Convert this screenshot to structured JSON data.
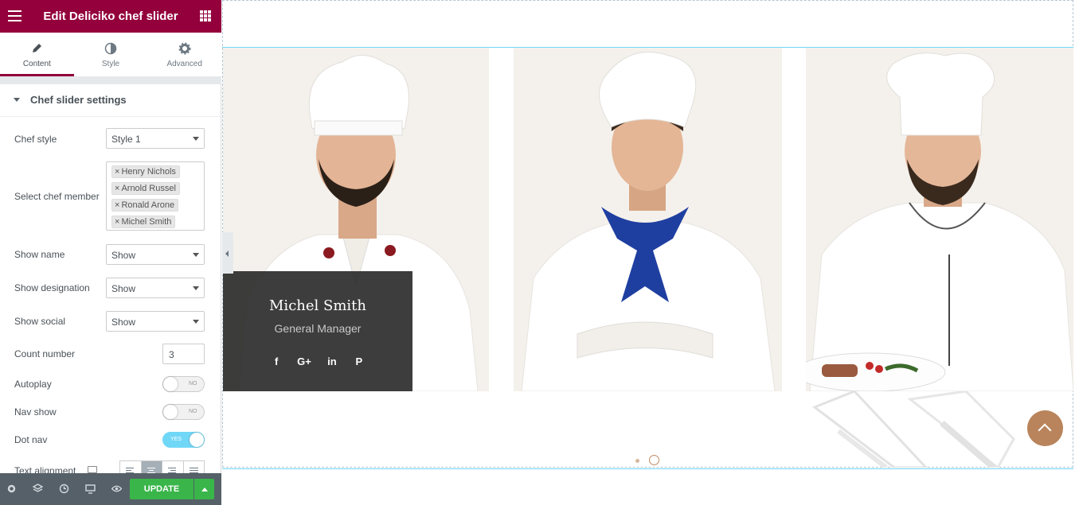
{
  "header": {
    "title": "Edit Deliciko chef slider"
  },
  "tabs": [
    {
      "label": "Content"
    },
    {
      "label": "Style"
    },
    {
      "label": "Advanced"
    }
  ],
  "section": {
    "title": "Chef slider settings"
  },
  "controls": {
    "chef_style": {
      "label": "Chef style",
      "value": "Style 1"
    },
    "select_member": {
      "label": "Select chef member",
      "tags": [
        "Henry Nichols",
        "Arnold Russel",
        "Ronald Arone",
        "Michel Smith"
      ]
    },
    "show_name": {
      "label": "Show name",
      "value": "Show"
    },
    "show_designation": {
      "label": "Show designation",
      "value": "Show"
    },
    "show_social": {
      "label": "Show social",
      "value": "Show"
    },
    "count_number": {
      "label": "Count number",
      "value": "3"
    },
    "autoplay": {
      "label": "Autoplay",
      "value": "NO"
    },
    "nav_show": {
      "label": "Nav show",
      "value": "NO"
    },
    "dot_nav": {
      "label": "Dot nav",
      "value": "YES"
    },
    "text_alignment": {
      "label": "Text alignment"
    }
  },
  "footer": {
    "update_label": "UPDATE"
  },
  "preview": {
    "featured_chef": {
      "name": "Michel Smith",
      "role": "General Manager"
    },
    "socials": [
      "f",
      "G+",
      "in",
      "P"
    ]
  },
  "colors": {
    "brand": "#93003c",
    "accent": "#71d7f7",
    "update": "#39b54a",
    "scroll_button": "#b9845c"
  }
}
